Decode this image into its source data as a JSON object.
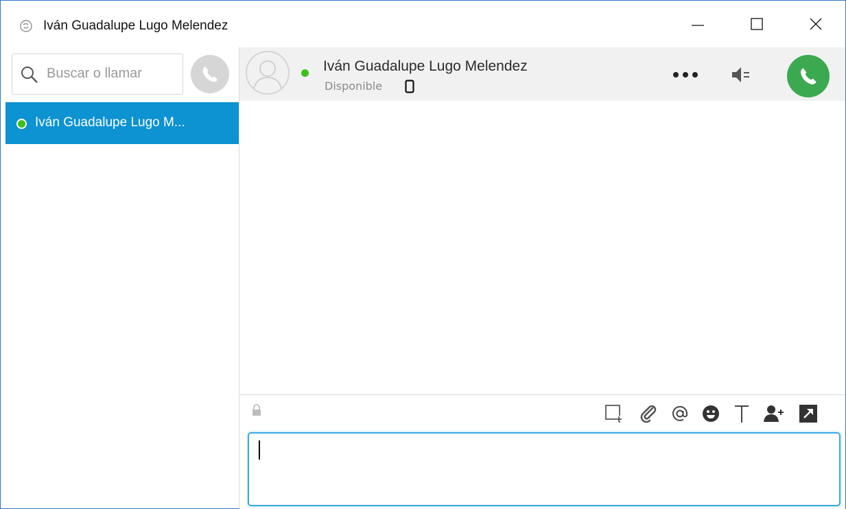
{
  "window": {
    "title": "Iván Guadalupe Lugo Melendez"
  },
  "sidebar": {
    "search_placeholder": "Buscar o llamar",
    "contacts": [
      {
        "name": "Iván Guadalupe Lugo M...",
        "status": "online",
        "selected": true
      }
    ]
  },
  "conversation": {
    "contact_name": "Iván Guadalupe Lugo Melendez",
    "status_text": "Disponible"
  },
  "colors": {
    "accent_blue": "#0d92d2",
    "online_green": "#3ec01b",
    "call_green": "#3ba94f",
    "input_focus": "#39a9e6"
  },
  "icons": {
    "app": "skype-like-icon",
    "search": "search-icon",
    "dial": "phone-icon",
    "more": "ellipsis-icon",
    "audio": "speaker-settings-icon",
    "call": "phone-icon",
    "lock": "lock-icon",
    "toolbar": [
      "screenshot-icon",
      "attach-icon",
      "mention-icon",
      "emoji-icon",
      "text-format-icon",
      "add-contact-icon",
      "popout-icon"
    ]
  },
  "compose": {
    "message_value": ""
  }
}
